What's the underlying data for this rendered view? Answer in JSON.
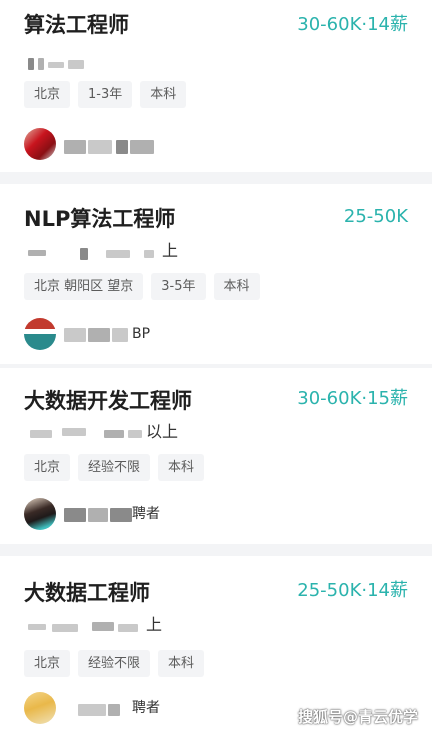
{
  "jobs": [
    {
      "title": "算法工程师",
      "salary": "30-60K·14薪",
      "subtitle_visible": "",
      "tags": [
        "北京",
        "1-3年",
        "本科"
      ],
      "recruiter_visible": ""
    },
    {
      "title": "NLP算法工程师",
      "salary": "25-50K",
      "subtitle_visible": "上",
      "tags": [
        "北京 朝阳区 望京",
        "3-5年",
        "本科"
      ],
      "recruiter_visible": "BP"
    },
    {
      "title": "大数据开发工程师",
      "salary": "30-60K·15薪",
      "subtitle_visible": "以上",
      "tags": [
        "北京",
        "经验不限",
        "本科"
      ],
      "recruiter_visible": "聘者"
    },
    {
      "title": "大数据工程师",
      "salary": "25-50K·14薪",
      "subtitle_visible": "上",
      "tags": [
        "北京",
        "经验不限",
        "本科"
      ],
      "recruiter_visible": "聘者"
    }
  ],
  "watermark": "搜狐号@青云优学",
  "colors": {
    "salary": "#2bb3ad",
    "tag_bg": "#f3f4f6",
    "page_bg": "#f3f4f6"
  }
}
